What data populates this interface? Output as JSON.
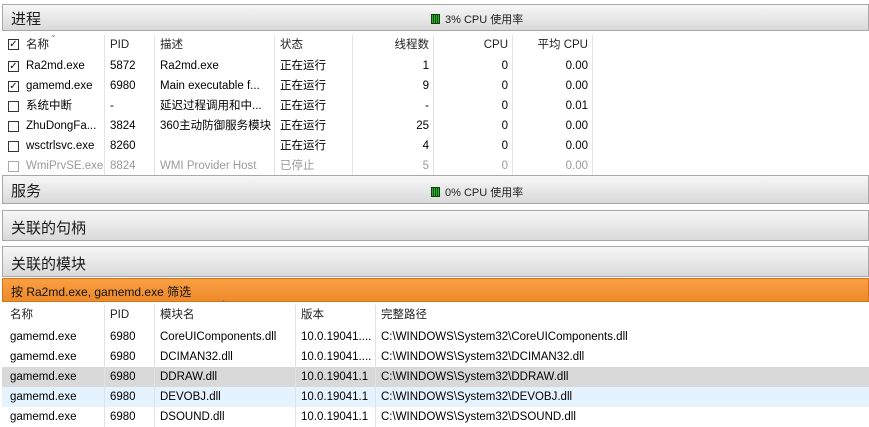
{
  "processes": {
    "title": "进程",
    "cpu_label": "3% CPU 使用率",
    "columns": [
      "名称",
      "PID",
      "描述",
      "状态",
      "线程数",
      "CPU",
      "平均 CPU"
    ],
    "rows": [
      {
        "checked": true,
        "name": "Ra2md.exe",
        "pid": "5872",
        "desc": "Ra2md.exe",
        "status": "正在运行",
        "threads": "1",
        "cpu": "0",
        "avg_cpu": "0.00"
      },
      {
        "checked": true,
        "name": "gamemd.exe",
        "pid": "6980",
        "desc": "Main executable f...",
        "status": "正在运行",
        "threads": "9",
        "cpu": "0",
        "avg_cpu": "0.00"
      },
      {
        "checked": false,
        "name": "系统中断",
        "pid": "-",
        "desc": "延迟过程调用和中...",
        "status": "正在运行",
        "threads": "-",
        "cpu": "0",
        "avg_cpu": "0.01"
      },
      {
        "checked": false,
        "name": "ZhuDongFa...",
        "pid": "3824",
        "desc": "360主动防御服务模块",
        "status": "正在运行",
        "threads": "25",
        "cpu": "0",
        "avg_cpu": "0.00"
      },
      {
        "checked": false,
        "name": "wsctrlsvc.exe",
        "pid": "8260",
        "desc": "",
        "status": "正在运行",
        "threads": "4",
        "cpu": "0",
        "avg_cpu": "0.00"
      },
      {
        "checked": false,
        "name": "WmiPrvSE.exe",
        "pid": "8824",
        "desc": "WMI Provider Host",
        "status": "已停止",
        "threads": "5",
        "cpu": "0",
        "avg_cpu": "0.00"
      }
    ]
  },
  "services": {
    "title": "服务",
    "cpu_label": "0% CPU 使用率"
  },
  "handles": {
    "title": "关联的句柄"
  },
  "modules": {
    "title": "关联的模块",
    "filter_label": "按 Ra2md.exe, gamemd.exe 筛选",
    "columns": [
      "名称",
      "PID",
      "模块名",
      "版本",
      "完整路径"
    ],
    "rows": [
      {
        "name": "gamemd.exe",
        "pid": "6980",
        "module": "CoreUIComponents.dll",
        "version": "10.0.19041....",
        "path": "C:\\WINDOWS\\System32\\CoreUIComponents.dll"
      },
      {
        "name": "gamemd.exe",
        "pid": "6980",
        "module": "DCIMAN32.dll",
        "version": "10.0.19041....",
        "path": "C:\\WINDOWS\\System32\\DCIMAN32.dll"
      },
      {
        "name": "gamemd.exe",
        "pid": "6980",
        "module": "DDRAW.dll",
        "version": "10.0.19041.1",
        "path": "C:\\WINDOWS\\System32\\DDRAW.dll"
      },
      {
        "name": "gamemd.exe",
        "pid": "6980",
        "module": "DEVOBJ.dll",
        "version": "10.0.19041.1",
        "path": "C:\\WINDOWS\\System32\\DEVOBJ.dll"
      },
      {
        "name": "gamemd.exe",
        "pid": "6980",
        "module": "DSOUND.dll",
        "version": "10.0.19041.1",
        "path": "C:\\WINDOWS\\System32\\DSOUND.dll"
      }
    ]
  },
  "colors": {
    "selected_row": "#d9d9d9",
    "hover_row": "#e5f3ff",
    "filter_bar": "#f39533",
    "cpu_meter": "#1e7a1e"
  }
}
